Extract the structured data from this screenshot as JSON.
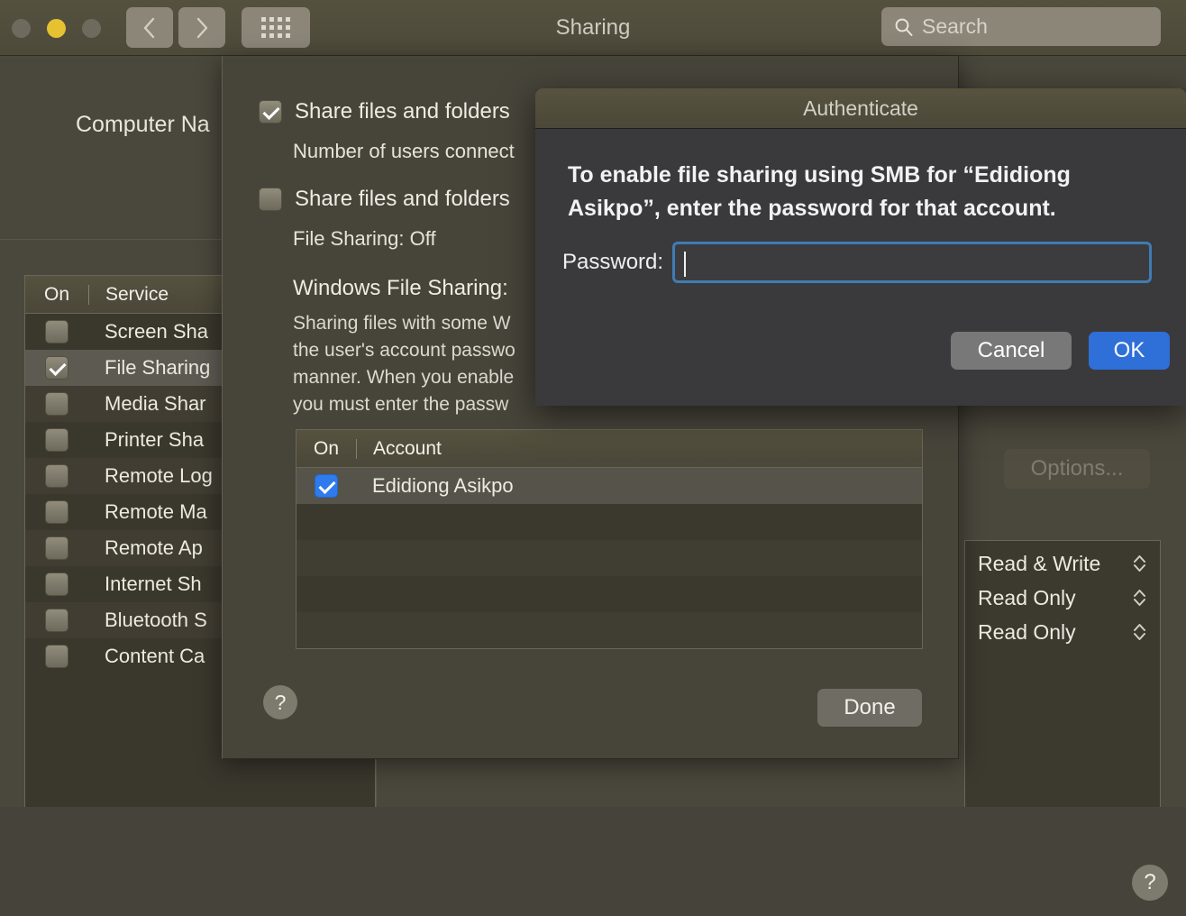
{
  "window": {
    "title": "Sharing",
    "traffic_lights": [
      "close",
      "minimize",
      "zoom"
    ],
    "back_icon": "chevron-left-icon",
    "forward_icon": "chevron-right-icon",
    "grid_icon": "show-all-grid-icon"
  },
  "search": {
    "placeholder": "Search",
    "value": "",
    "icon": "search-icon"
  },
  "prefs": {
    "computer_name_label": "Computer Na",
    "services_table": {
      "columns": [
        "On",
        "Service"
      ],
      "rows": [
        {
          "label": "Screen Sha",
          "checked": false,
          "selected": false
        },
        {
          "label": "File Sharing",
          "checked": true,
          "selected": true
        },
        {
          "label": "Media Shar",
          "checked": false,
          "selected": false
        },
        {
          "label": "Printer Sha",
          "checked": false,
          "selected": false
        },
        {
          "label": "Remote Log",
          "checked": false,
          "selected": false
        },
        {
          "label": "Remote Ma",
          "checked": false,
          "selected": false
        },
        {
          "label": "Remote Ap",
          "checked": false,
          "selected": false
        },
        {
          "label": "Internet Sh",
          "checked": false,
          "selected": false
        },
        {
          "label": "Bluetooth S",
          "checked": false,
          "selected": false
        },
        {
          "label": "Content Ca",
          "checked": false,
          "selected": false
        }
      ]
    },
    "options_button": "Options...",
    "permissions": [
      "Read & Write",
      "Read Only",
      "Read Only"
    ],
    "add_label": "+",
    "remove_label": "—",
    "help_label": "?"
  },
  "smb_sheet": {
    "checkbox_afp": {
      "label": "Share files and folders",
      "checked": true
    },
    "users_connected": "Number of users connect",
    "checkbox_smb": {
      "label": "Share files and folders",
      "checked": false
    },
    "file_sharing_status": "File Sharing: Off",
    "windows_heading": "Windows File Sharing:",
    "windows_body": "Sharing files with some W\nthe user's account passwo\nmanner. When you enable\nyou must enter the passw",
    "accounts_table": {
      "columns": [
        "On",
        "Account"
      ],
      "rows": [
        {
          "name": "Edidiong Asikpo",
          "checked": true,
          "selected": true
        }
      ],
      "empty_rows": 5
    },
    "done_label": "Done",
    "help_label": "?"
  },
  "auth_dialog": {
    "title": "Authenticate",
    "message": "To enable file sharing using SMB for “Edidiong Asikpo”, enter the password for that account.",
    "password_label": "Password:",
    "password_value": "",
    "cancel_label": "Cancel",
    "ok_label": "OK"
  },
  "colors": {
    "accent_blue": "#2f6fd8",
    "field_focus_ring": "#3f7cb4",
    "checkbox_blue": "#2f7bed",
    "window_chrome": "#4e4a3a",
    "dialog_bg": "#3a3a3c",
    "minimize_yellow": "#e6c231"
  }
}
